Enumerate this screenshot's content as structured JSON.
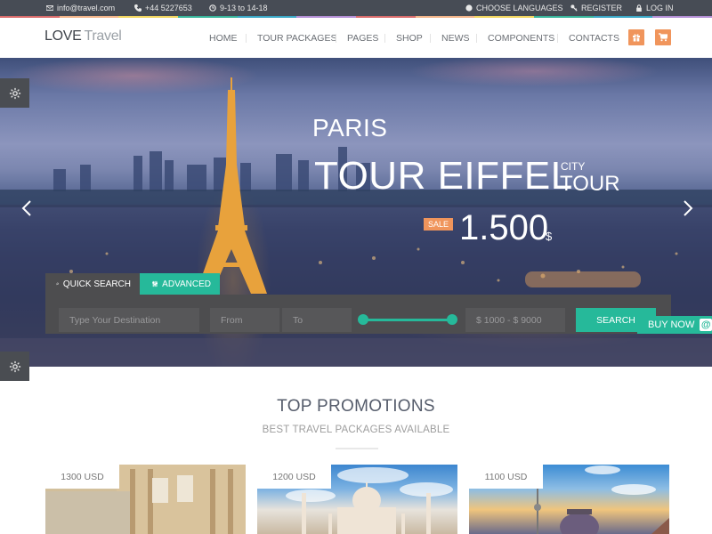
{
  "topbar": {
    "email": "info@travel.com",
    "phone": "+44 5227653",
    "hours": "9-13 to 14-18",
    "languages": "CHOOSE LANGUAGES",
    "register": "REGISTER",
    "login": "LOG IN",
    "stripe_colors": [
      "#d96b6b",
      "#f3b58a",
      "#f2d660",
      "#37b59b",
      "#3aa8c7",
      "#b48fd6"
    ]
  },
  "header": {
    "logo_bold": "LOVE",
    "logo_light": "Travel",
    "nav": [
      "HOME",
      "TOUR PACKAGES",
      "PAGES",
      "SHOP",
      "NEWS",
      "COMPONENTS",
      "CONTACTS"
    ],
    "gift_icon": "gift-icon",
    "cart_icon": "cart-icon",
    "accent": "#f0955c"
  },
  "hero": {
    "city": "PARIS",
    "title": "TOUR EIFFEL",
    "subtitle_small": "CITY",
    "subtitle_large": "TOUR",
    "sale_badge": "SALE",
    "price": "1.500",
    "currency": "$"
  },
  "search": {
    "tab_quick": "QUICK SEARCH",
    "tab_advanced": "ADVANCED",
    "destination_placeholder": "Type Your Destination",
    "from_placeholder": "From",
    "to_placeholder": "To",
    "price_range": "$ 1000 - $ 9000",
    "range_min_fraction": 0.0,
    "range_max_fraction": 1.0,
    "search_button": "SEARCH",
    "accent": "#26b99a"
  },
  "buy_now": "BUY NOW",
  "promotions": {
    "title": "TOP PROMOTIONS",
    "subtitle": "BEST TRAVEL PACKAGES AVAILABLE",
    "cards": [
      {
        "price": "1300 USD"
      },
      {
        "price": "1200 USD"
      },
      {
        "price": "1100 USD"
      }
    ]
  }
}
